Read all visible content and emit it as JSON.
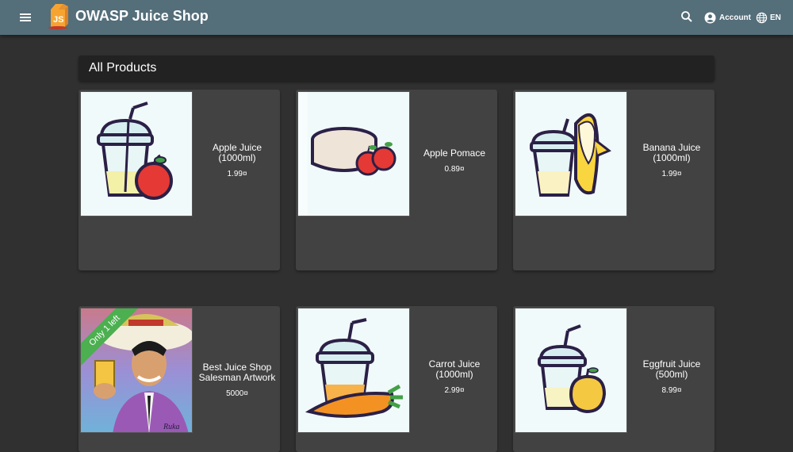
{
  "header": {
    "title": "OWASP Juice Shop",
    "account_label": "Account",
    "language_label": "EN"
  },
  "main": {
    "heading": "All Products",
    "products": [
      {
        "name": "Apple Juice (1000ml)",
        "price": "1.99¤"
      },
      {
        "name": "Apple Pomace",
        "price": "0.89¤"
      },
      {
        "name": "Banana Juice (1000ml)",
        "price": "1.99¤"
      },
      {
        "name": "Best Juice Shop Salesman Artwork",
        "price": "5000¤",
        "badge": "Only 1 left"
      },
      {
        "name": "Carrot Juice (1000ml)",
        "price": "2.99¤"
      },
      {
        "name": "Eggfruit Juice (500ml)",
        "price": "8.99¤"
      }
    ]
  },
  "colors": {
    "toolbar": "#546e7a",
    "background": "#303030",
    "card": "#424242",
    "badge": "#4caf50"
  },
  "icons": [
    "menu-icon",
    "juice-shop-logo",
    "search-icon",
    "account-circle-icon",
    "globe-icon"
  ]
}
